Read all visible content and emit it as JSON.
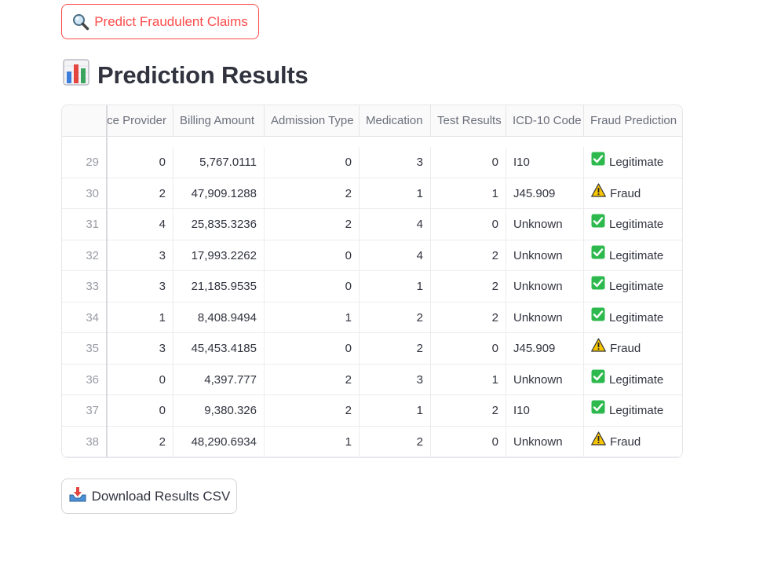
{
  "buttons": {
    "predict_label": "Predict Fraudulent Claims",
    "download_label": "Download Results CSV"
  },
  "title": "Prediction Results",
  "table": {
    "columns": [
      "ce Provider",
      "Billing Amount",
      "Admission Type",
      "Medication",
      "Test Results",
      "ICD-10 Code",
      "Fraud Prediction"
    ],
    "rows": [
      {
        "index": "29",
        "provider": "0",
        "billing": "5,767.0111",
        "admission": "0",
        "medication": "3",
        "test": "0",
        "icd": "I10",
        "prediction": "Legitimate",
        "status": "legit"
      },
      {
        "index": "30",
        "provider": "2",
        "billing": "47,909.1288",
        "admission": "2",
        "medication": "1",
        "test": "1",
        "icd": "J45.909",
        "prediction": "Fraud",
        "status": "fraud"
      },
      {
        "index": "31",
        "provider": "4",
        "billing": "25,835.3236",
        "admission": "2",
        "medication": "4",
        "test": "0",
        "icd": "Unknown",
        "prediction": "Legitimate",
        "status": "legit"
      },
      {
        "index": "32",
        "provider": "3",
        "billing": "17,993.2262",
        "admission": "0",
        "medication": "4",
        "test": "2",
        "icd": "Unknown",
        "prediction": "Legitimate",
        "status": "legit"
      },
      {
        "index": "33",
        "provider": "3",
        "billing": "21,185.9535",
        "admission": "0",
        "medication": "1",
        "test": "2",
        "icd": "Unknown",
        "prediction": "Legitimate",
        "status": "legit"
      },
      {
        "index": "34",
        "provider": "1",
        "billing": "8,408.9494",
        "admission": "1",
        "medication": "2",
        "test": "2",
        "icd": "Unknown",
        "prediction": "Legitimate",
        "status": "legit"
      },
      {
        "index": "35",
        "provider": "3",
        "billing": "45,453.4185",
        "admission": "0",
        "medication": "2",
        "test": "0",
        "icd": "J45.909",
        "prediction": "Fraud",
        "status": "fraud"
      },
      {
        "index": "36",
        "provider": "0",
        "billing": "4,397.777",
        "admission": "2",
        "medication": "3",
        "test": "1",
        "icd": "Unknown",
        "prediction": "Legitimate",
        "status": "legit"
      },
      {
        "index": "37",
        "provider": "0",
        "billing": "9,380.326",
        "admission": "2",
        "medication": "1",
        "test": "2",
        "icd": "I10",
        "prediction": "Legitimate",
        "status": "legit"
      },
      {
        "index": "38",
        "provider": "2",
        "billing": "48,290.6934",
        "admission": "1",
        "medication": "2",
        "test": "0",
        "icd": "Unknown",
        "prediction": "Fraud",
        "status": "fraud"
      }
    ]
  },
  "icons": {
    "predict": "magnifier-icon",
    "title": "bar-chart-icon",
    "legit": "check-mark-icon",
    "fraud": "warning-icon",
    "download": "download-tray-icon"
  },
  "colors": {
    "accent": "#ff4b4b",
    "legit": "#2eb94e",
    "fraud": "#f7c500"
  }
}
